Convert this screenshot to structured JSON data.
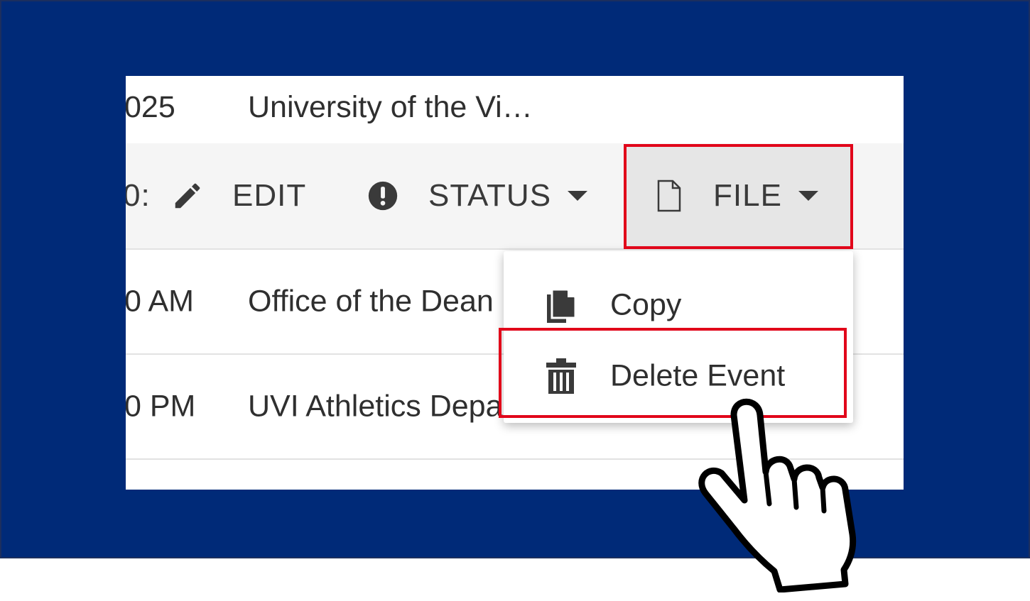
{
  "rows": [
    {
      "time": "025",
      "org": "University of the Vi…"
    },
    {
      "time": "0 AM",
      "org": "Office of the Dean"
    },
    {
      "time": "0 PM",
      "org": "UVI Athletics Depa"
    }
  ],
  "toolbar": {
    "partial_text": "0:",
    "edit_label": "EDIT",
    "status_label": "STATUS",
    "file_label": "FILE"
  },
  "file_menu": {
    "items": [
      {
        "label": "Copy",
        "icon": "copy-icon"
      },
      {
        "label": "Delete Event",
        "icon": "trash-icon"
      }
    ]
  },
  "colors": {
    "frame": "#002a78",
    "highlight": "#e1061a",
    "toolbar_bg": "#f5f5f5",
    "active_button_bg": "#e6e6e6"
  }
}
